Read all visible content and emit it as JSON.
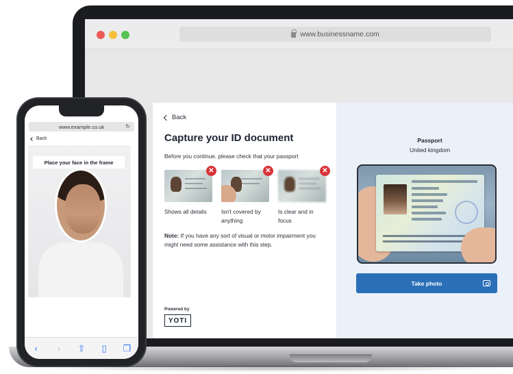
{
  "browser": {
    "url": "www.businessname.com"
  },
  "page": {
    "back_label": "Back",
    "title": "Capture your ID document",
    "subtitle": "Before you continue, please check that your passport",
    "checks": [
      {
        "label": "Shows all details"
      },
      {
        "label": "Isn't covered by anything"
      },
      {
        "label": "Is clear and in focus"
      }
    ],
    "note_bold": "Note:",
    "note_text": " If you have any sort of visual or motor impairment you might need some assistance with this step.",
    "powered_by": "Powered by",
    "brand": "YOTI"
  },
  "capture": {
    "document_type": "Passport",
    "country": "United kingdom",
    "take_photo_label": "Take photo"
  },
  "phone": {
    "url": "www.example.co.uk",
    "back_label": "Back",
    "instruction": "Place your face in the frame"
  },
  "icons": {
    "reject": "x-icon",
    "camera": "camera-icon",
    "back": "chevron-left-icon"
  },
  "colors": {
    "primary_button": "#2a6fb8",
    "reject_badge": "#d8343a",
    "capture_panel": "#eaf1f8"
  }
}
